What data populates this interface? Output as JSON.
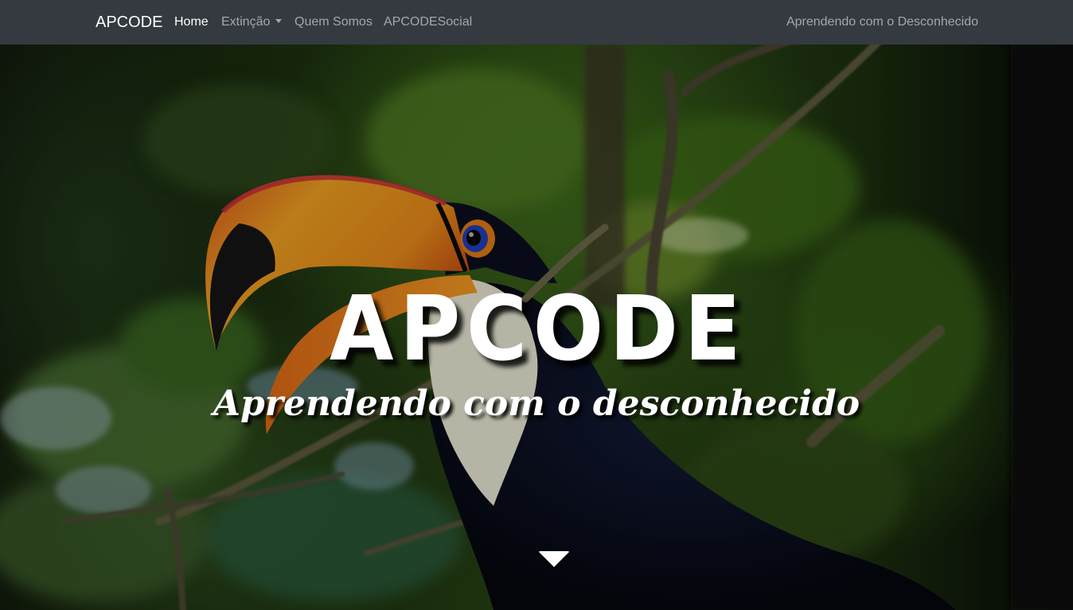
{
  "navbar": {
    "brand": "APCODE",
    "links": [
      {
        "label": "Home",
        "active": true
      },
      {
        "label": "Extinção",
        "dropdown": true
      },
      {
        "label": "Quem Somos"
      },
      {
        "label": "APCODESocial"
      }
    ],
    "right_text": "Aprendendo com o Desconhecido"
  },
  "hero": {
    "title": "APCODE",
    "subtitle": "Aprendendo com o desconhecido",
    "background_image": "toucan-on-branch",
    "scroll_icon": "chevron-down-icon"
  },
  "colors": {
    "navbar_bg": "#343a40",
    "text_light": "#ffffff",
    "link_muted": "rgba(255,255,255,0.55)"
  }
}
